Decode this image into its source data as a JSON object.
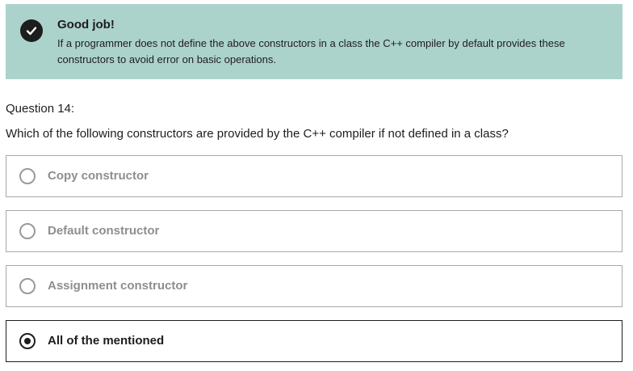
{
  "feedback": {
    "title": "Good job!",
    "message": "If a programmer does not define the above constructors in a class the C++ compiler by default provides these constructors to avoid error on basic operations.",
    "icon": "check-circle-icon",
    "background_color": "#acd2cc"
  },
  "question": {
    "label": "Question 14:",
    "text": "Which of the following constructors are provided by the C++ compiler if not defined in a class?"
  },
  "options": [
    {
      "label": "Copy constructor",
      "selected": false
    },
    {
      "label": "Default constructor",
      "selected": false
    },
    {
      "label": "Assignment constructor",
      "selected": false
    },
    {
      "label": "All of the mentioned",
      "selected": true
    }
  ]
}
